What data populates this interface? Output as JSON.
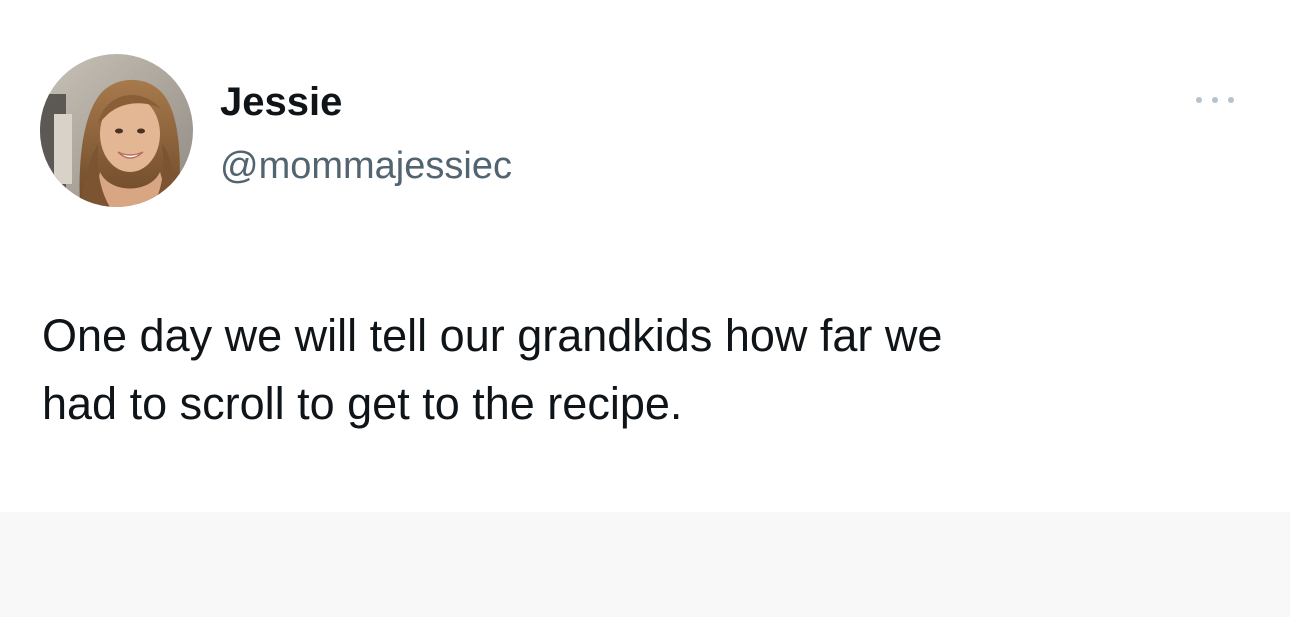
{
  "tweet": {
    "author": {
      "display_name": "Jessie",
      "handle": "@mommajessiec",
      "avatar_icon": "profile-photo"
    },
    "more_icon": "more-options-icon",
    "text_lines": [
      "One day we will tell our grandkids how far we",
      "had to scroll to get to the recipe."
    ]
  },
  "colors": {
    "name": "#0f1419",
    "handle": "#536471",
    "more_dots": "#b6c1ca",
    "background": "#ffffff",
    "lower_band": "#f8f8f8"
  }
}
